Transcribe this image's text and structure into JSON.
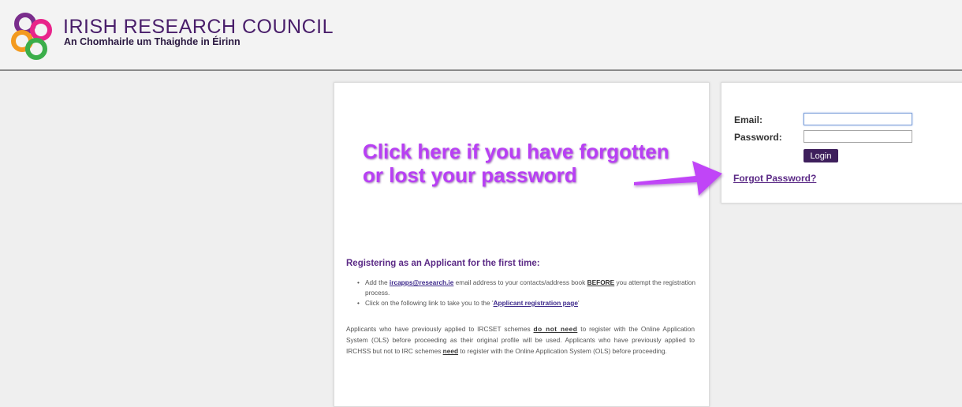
{
  "header": {
    "org_name": "IRISH RESEARCH COUNCIL",
    "org_subtitle": "An Chomhairle um Thaighde in Éirinn"
  },
  "annotation": {
    "line1": "Click here if you have forgotten",
    "line2": "or lost your password"
  },
  "login": {
    "email_label": "Email:",
    "password_label": "Password:",
    "email_value": "",
    "password_value": "",
    "login_button": "Login",
    "forgot_link": "Forgot Password?"
  },
  "registration": {
    "title": "Registering as an Applicant for the first time:",
    "bullet1": {
      "pre": "Add the ",
      "email_link": "ircapps@research.ie",
      "mid": " email address to your contacts/address book ",
      "emph": "BEFORE",
      "post": " you attempt the registration process."
    },
    "bullet2": {
      "pre": "Click on the following link to take you to the '",
      "link": "Applicant registration page",
      "post": "'"
    },
    "paragraph": {
      "p1": "Applicants who have previously applied to IRCSET schemes ",
      "b1": "do not need",
      "p2": " to register with the Online Application System (OLS) before proceeding as their original profile will be used. Applicants who have previously applied to IRCHSS but not to IRC schemes ",
      "b2": "need",
      "p3": " to register with the Online Application System (OLS) before proceeding."
    }
  },
  "colors": {
    "brand_purple": "#5b2a86",
    "annotation_magenta": "#b83ff4",
    "button_bg": "#3e1f5c"
  }
}
